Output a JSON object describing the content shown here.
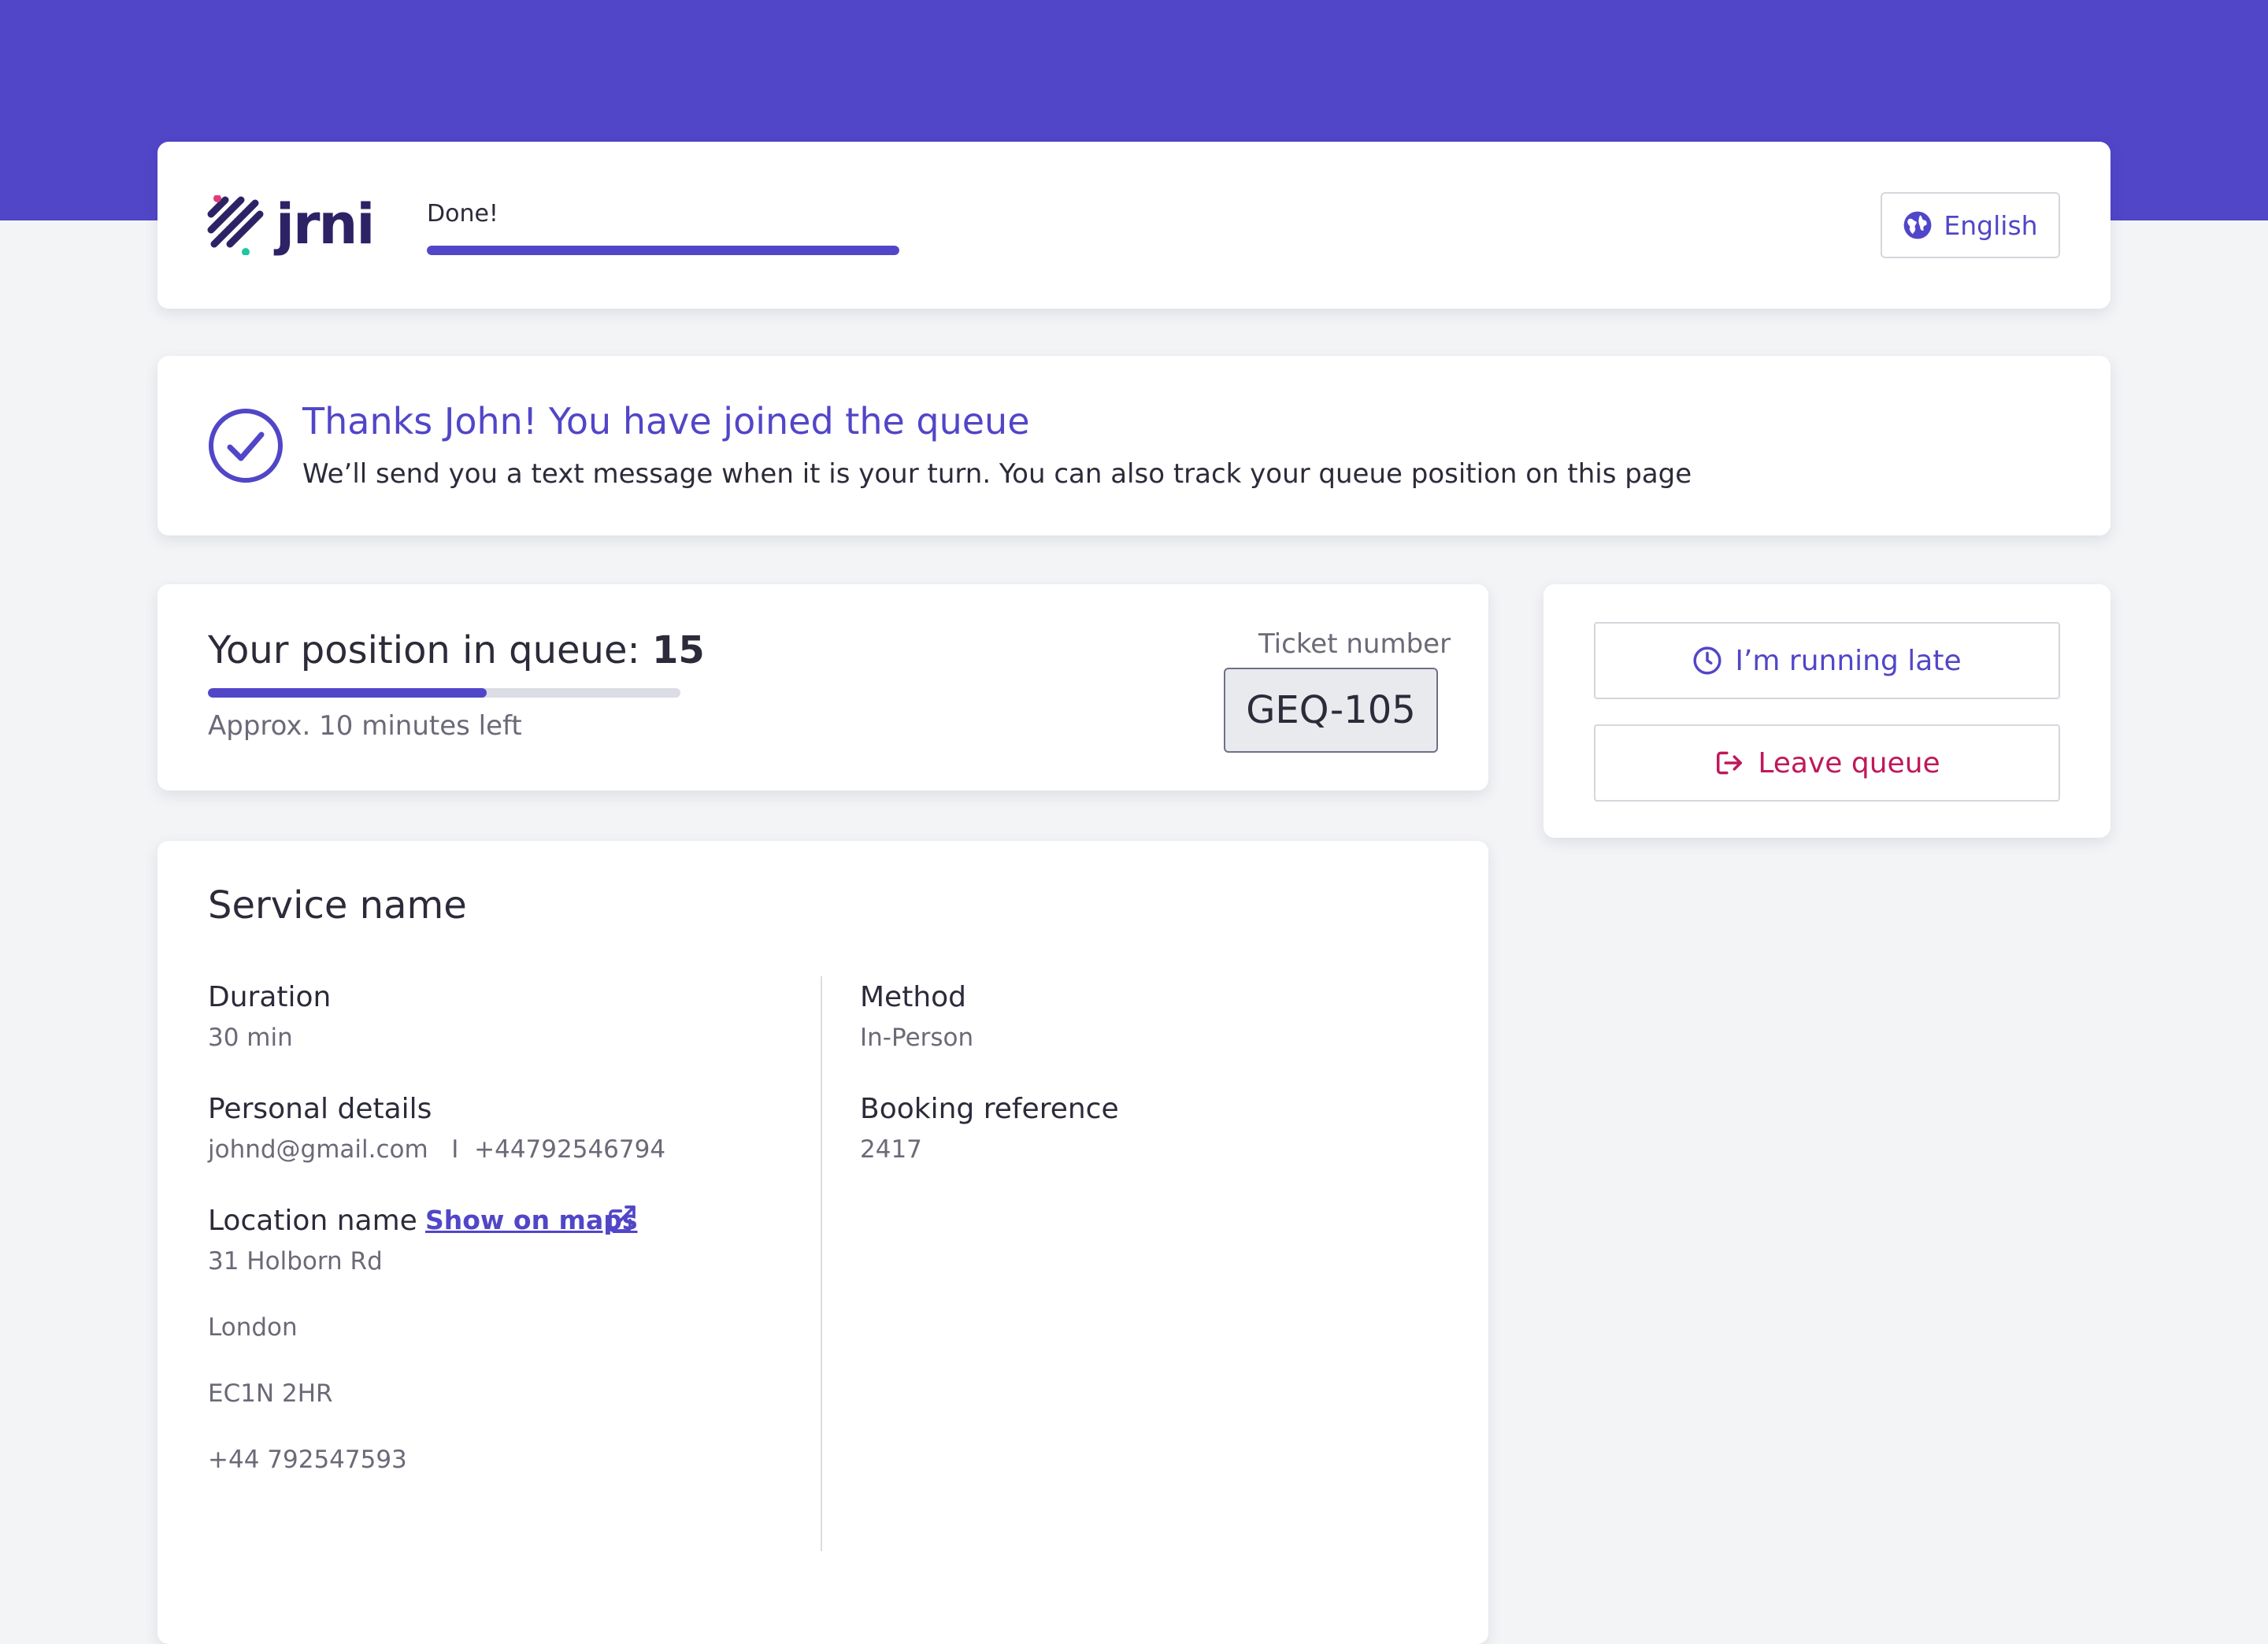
{
  "header": {
    "logo_text": "jrni",
    "progress_label": "Done!",
    "progress_fraction": 1.0,
    "language_button": "English"
  },
  "confirmation": {
    "title": "Thanks John! You have joined the queue",
    "subtitle": "We’ll send you a text message when it is your turn. You can also track your queue position on this page"
  },
  "queue": {
    "position_label": "Your position in queue:",
    "position_value": "15",
    "progress_fraction": 0.59,
    "eta": "Approx. 10 minutes left",
    "ticket_label": "Ticket number",
    "ticket_number": "GEQ-105"
  },
  "actions": {
    "running_late": "I’m running late",
    "leave_queue": "Leave queue"
  },
  "details": {
    "service_name": "Service name",
    "duration_label": "Duration",
    "duration_value": "30 min",
    "personal_label": "Personal details",
    "personal_value": "johnd@gmail.com   I  +44792546794",
    "location_label": "Location name",
    "maps_link": "Show on maps",
    "address_line1": "31 Holborn Rd",
    "address_line2": "London",
    "address_line3": "EC1N 2HR",
    "address_phone": "+44 792547593",
    "method_label": "Method",
    "method_value": "In-Person",
    "booking_label": "Booking reference",
    "booking_value": "2417"
  },
  "colors": {
    "brand": "#5146c8",
    "danger": "#c0185a",
    "background": "#f3f4f6"
  }
}
